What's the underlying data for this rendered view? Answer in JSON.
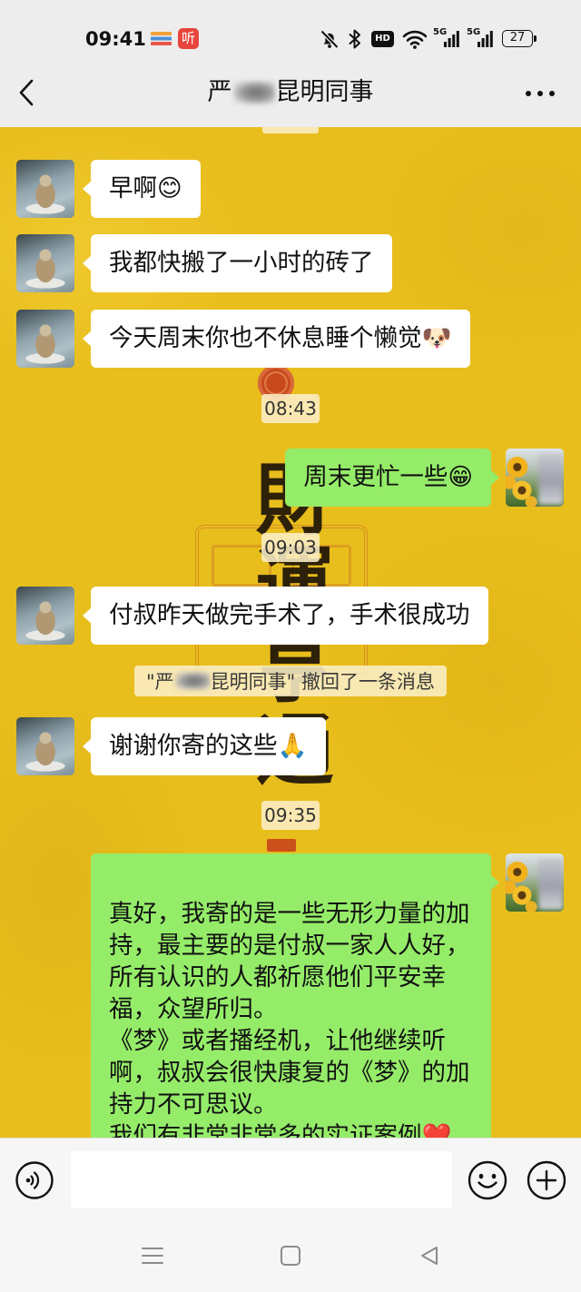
{
  "status_bar": {
    "time": "09:41",
    "app_badge": "听",
    "hd_label": "HD",
    "network_1": "5G",
    "network_2": "5G",
    "battery_level": "27",
    "icons": [
      "stripes-icon",
      "ting-app-icon",
      "mute-icon",
      "bluetooth-icon",
      "hd-icon",
      "wifi-icon",
      "signal-icon",
      "signal-icon",
      "battery-icon"
    ]
  },
  "header": {
    "title_prefix": "严",
    "title_suffix": "昆明同事",
    "icons": [
      "back-icon",
      "more-icon"
    ]
  },
  "wallpaper": {
    "calligraphy": "財運亨通"
  },
  "chat": {
    "items": [
      {
        "incoming": "早啊😊"
      },
      {
        "incoming": "我都快搬了一小时的砖了"
      },
      {
        "incoming": "今天周末你也不休息睡个懒觉🐶"
      },
      {
        "time": "08:43"
      },
      {
        "outgoing": "周末更忙一些😁"
      },
      {
        "time": "09:03"
      },
      {
        "incoming": "付叔昨天做完手术了，手术很成功"
      },
      {
        "recall_prefix": "\"严",
        "recall_suffix": "昆明同事\" 撤回了一条消息"
      },
      {
        "incoming": "谢谢你寄的这些🙏"
      },
      {
        "time": "09:35"
      },
      {
        "outgoing": "真好，我寄的是一些无形力量的加持，最主要的是付叔一家人人好，所有认识的人都祈愿他们平安幸福，众望所归。\n《梦》或者播经机，让他继续听啊，叔叔会很快康复的《梦》的加持力不可思议。\n我们有非常非常多的实证案例❤️"
      }
    ]
  },
  "input_bar": {
    "icons": [
      "voice-icon",
      "emoji-icon",
      "plus-icon"
    ]
  },
  "nav_bar": {
    "icons": [
      "menu-icon",
      "home-icon",
      "back-icon"
    ]
  },
  "colors": {
    "wallpaper": "#e8be1d",
    "bubble_incoming": "#ffffff",
    "bubble_outgoing": "#95ec69",
    "top_bar": "#ededed",
    "bottom_bar": "#f6f6f6"
  }
}
